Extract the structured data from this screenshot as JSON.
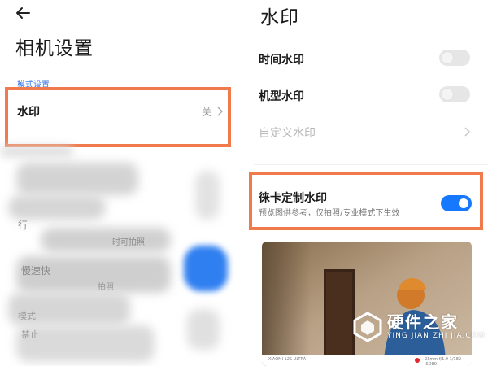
{
  "left": {
    "title": "相机设置",
    "section_header": "模式设置",
    "watermark_row": {
      "label": "水印",
      "value": "关"
    },
    "blurred_fragments": [
      "行",
      "时可拍照",
      "慢速快",
      "",
      "拍照",
      "模式",
      "禁止"
    ]
  },
  "right": {
    "title": "水印",
    "items": [
      {
        "label": "时间水印",
        "state": "off"
      },
      {
        "label": "机型水印",
        "state": "off"
      },
      {
        "label": "自定义水印",
        "state": "disabled"
      }
    ],
    "leica": {
      "label": "徕卡定制水印",
      "subtitle": "预览图供参考，仅拍照/专业模式下生效",
      "state": "on"
    },
    "preview_strip": {
      "model": "XIAOMI 12S ULTRA",
      "params": "23mm f/1.9 1/182 ISO80"
    }
  },
  "site_watermark": {
    "name": "硬件之家",
    "url": "YING JIAN ZHI JIA.COM"
  },
  "colors": {
    "accent": "#1677ff",
    "highlight": "#f07a4b",
    "section": "#3b78e7"
  }
}
